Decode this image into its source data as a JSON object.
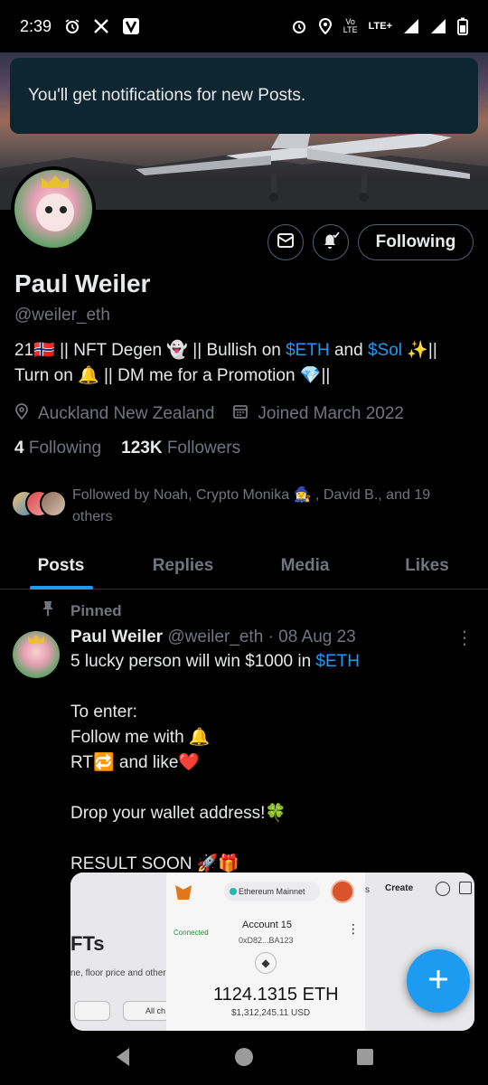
{
  "status_bar": {
    "time": "2:39",
    "left_icons": [
      "alarm-icon",
      "x-app-icon",
      "v-app-icon"
    ],
    "right_icons": [
      "alarm-icon",
      "location-icon",
      "volte-icon",
      "lte-plus-icon",
      "signal-icon",
      "signal-icon",
      "battery-icon"
    ],
    "volte_label": "Vo \nLTE",
    "lte_label": "LTE+"
  },
  "toast": {
    "message": "You'll get notifications for new Posts."
  },
  "profile": {
    "name": "Paul Weiler",
    "handle": "@weiler_eth",
    "bio": {
      "part1": "21🇳🇴 || NFT Degen 👻 || Bullish on ",
      "link1": "$ETH",
      "part2": " and ",
      "link2": "$Sol",
      "part3": " ✨|| Turn on 🔔 || DM me for a Promotion 💎||"
    },
    "location": "Auckland New Zealand",
    "joined": "Joined March 2022",
    "following_count": "4",
    "following_label": "Following",
    "followers_count": "123K",
    "followers_label": "Followers",
    "followed_by": "Followed by Noah, Crypto Monika 🧙‍♀️ , David B., and 19 others",
    "follow_button": "Following"
  },
  "tabs": [
    {
      "label": "Posts",
      "active": true
    },
    {
      "label": "Replies",
      "active": false
    },
    {
      "label": "Media",
      "active": false
    },
    {
      "label": "Likes",
      "active": false
    }
  ],
  "post": {
    "pinned_label": "Pinned",
    "author": "Paul Weiler",
    "handle_date": "@weiler_eth · 08 Aug 23",
    "line1_text": "5 lucky person will win $1000 in ",
    "line1_link": "$ETH",
    "line2": "To enter:",
    "line3": "Follow me with 🔔",
    "line4": "RT🔁 and like❤️",
    "line5": "Drop your wallet address!🍀",
    "line6": "RESULT SOON 🚀🎁"
  },
  "media": {
    "left_heading": "FTs",
    "left_sub": "ne, floor price and other s",
    "left_pill2": "All ch",
    "network": "Ethereum Mainnet",
    "connected": "Connected",
    "account": "Account 15",
    "address": "0xD82...BA123",
    "balance": "1124.1315 ETH",
    "usd": "$1,312,245.11 USD",
    "right_s": "s",
    "right_create": "Create",
    "more_dots": "⋮"
  },
  "colors": {
    "accent": "#1d9bf0",
    "muted": "#71767b",
    "text": "#e7e9ea",
    "toast_bg": "#0e2532"
  }
}
